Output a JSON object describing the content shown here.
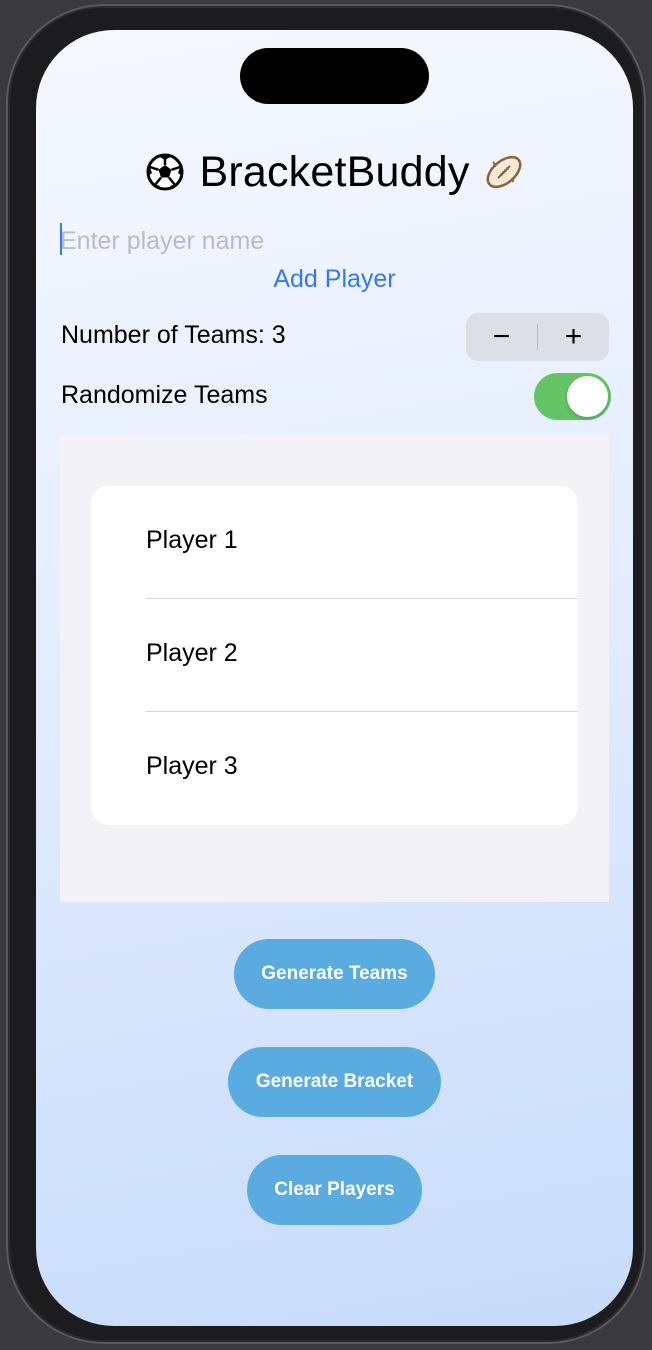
{
  "app": {
    "title": "BracketBuddy",
    "title_left_icon": "soccer-ball-icon",
    "title_right_icon": "american-football-icon"
  },
  "player_input": {
    "placeholder": "Enter player name",
    "value": ""
  },
  "add_player": {
    "label": "Add Player"
  },
  "teams": {
    "label": "Number of Teams: 3",
    "count": 3,
    "decrement_label": "−",
    "increment_label": "+"
  },
  "randomize": {
    "label": "Randomize Teams",
    "on": true
  },
  "players": [
    {
      "name": "Player 1"
    },
    {
      "name": "Player 2"
    },
    {
      "name": "Player 3"
    }
  ],
  "actions": {
    "generate_teams": "Generate Teams",
    "generate_bracket": "Generate Bracket",
    "clear_players": "Clear Players"
  },
  "colors": {
    "accent": "#3478f6",
    "toggle_on": "#65c466",
    "action_button": "#5aabe0"
  }
}
